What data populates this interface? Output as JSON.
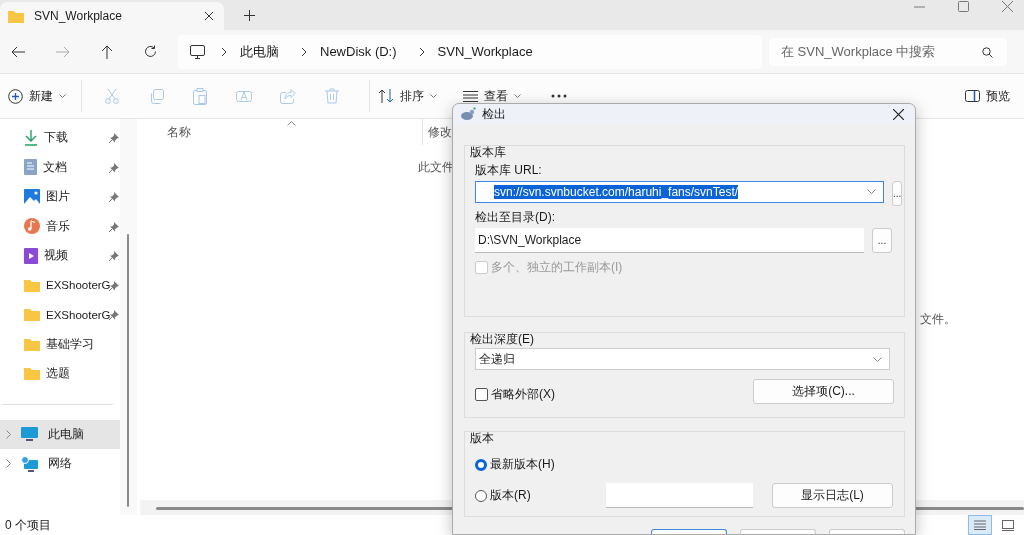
{
  "window": {
    "tab_title": "SVN_Workplace"
  },
  "address": {
    "crumbs": [
      "此电脑",
      "NewDisk (D:)",
      "SVN_Workplace"
    ]
  },
  "search": {
    "placeholder": "在 SVN_Workplace 中搜索"
  },
  "toolbar": {
    "new": "新建",
    "sort": "排序",
    "view": "查看",
    "preview": "预览",
    "actions": [
      {
        "kind": "cut",
        "disabled": true
      },
      {
        "kind": "copy",
        "disabled": true
      },
      {
        "kind": "paste",
        "disabled": true
      },
      {
        "kind": "rename",
        "disabled": true
      },
      {
        "kind": "share",
        "disabled": true
      },
      {
        "kind": "delete",
        "disabled": true
      }
    ]
  },
  "sidebar": {
    "items": [
      {
        "label": "下载",
        "kind": "download",
        "pinned": true
      },
      {
        "label": "文档",
        "kind": "document",
        "pinned": true
      },
      {
        "label": "图片",
        "kind": "picture",
        "pinned": true
      },
      {
        "label": "音乐",
        "kind": "music",
        "pinned": true
      },
      {
        "label": "视频",
        "kind": "video",
        "pinned": true
      },
      {
        "label": "EXShooterG",
        "kind": "folder",
        "pinned": true
      },
      {
        "label": "EXShooterG",
        "kind": "folder",
        "pinned": true
      },
      {
        "label": "基础学习",
        "kind": "folder",
        "pinned": false
      },
      {
        "label": "选题",
        "kind": "folder",
        "pinned": false
      }
    ],
    "devices": [
      {
        "label": "此电脑",
        "kind": "pc",
        "selected": true
      },
      {
        "label": "网络",
        "kind": "network",
        "selected": false
      }
    ]
  },
  "table": {
    "columns": [
      "名称",
      "修改"
    ]
  },
  "empty_message_parts": [
    "此文件",
    "文件。"
  ],
  "status_bar": {
    "count": "0 个项目"
  },
  "views": [
    {
      "kind": "details",
      "selected": true
    },
    {
      "kind": "tiles",
      "selected": false
    }
  ],
  "dialog": {
    "title": "检出",
    "repository": {
      "heading": "版本库",
      "url_label": "版本库 URL:",
      "url": "svn://svn.svnbucket.com/haruhi_fans/svnTest/",
      "url_selected": true,
      "browse": "...",
      "dir_label": "检出至目录(D):",
      "dir": "D:\\SVN_Workplace",
      "dir_browse": "...",
      "multiple": {
        "label": "多个、独立的工作副本(I)",
        "checked": false,
        "disabled": true
      }
    },
    "depth": {
      "heading": "检出深度(E)",
      "value": "全递归",
      "omit_externals": {
        "label": "省略外部(X)",
        "checked": false
      },
      "options_button": "选择项(C)..."
    },
    "revision": {
      "heading": "版本",
      "options": [
        {
          "label": "最新版本(H)",
          "selected": true
        },
        {
          "label": "版本(R)",
          "selected": false
        }
      ],
      "log_button": "显示日志(L)"
    }
  }
}
